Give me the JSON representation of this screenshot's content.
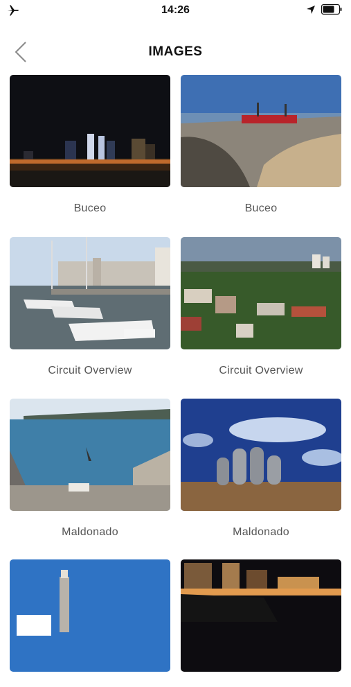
{
  "status_bar": {
    "time": "14:26"
  },
  "nav": {
    "title": "IMAGES"
  },
  "tiles": [
    {
      "caption": "Buceo"
    },
    {
      "caption": "Buceo"
    },
    {
      "caption": "Circuit Overview"
    },
    {
      "caption": "Circuit Overview"
    },
    {
      "caption": "Maldonado"
    },
    {
      "caption": "Maldonado"
    },
    {
      "caption": ""
    },
    {
      "caption": ""
    }
  ]
}
